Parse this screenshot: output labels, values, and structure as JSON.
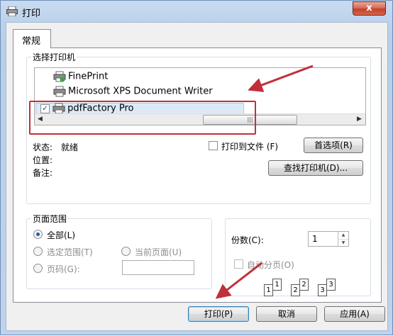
{
  "window": {
    "title": "打印",
    "close_symbol": "x",
    "icon": "printer-icon"
  },
  "tabs": [
    {
      "label": "常规",
      "selected": true
    }
  ],
  "select_printer": {
    "group_label": "选择打印机",
    "printers": [
      {
        "name": "FinePrint",
        "icon": "printer-icon",
        "selected": false
      },
      {
        "name": "Microsoft XPS Document Writer",
        "icon": "printer-icon",
        "selected": false
      },
      {
        "name": "pdfFactory Pro",
        "icon": "printer-icon",
        "selected": true,
        "checked": true
      }
    ],
    "scrollbar_thumb": "|||",
    "status_label": "状态:",
    "status_value": "就绪",
    "location_label": "位置:",
    "comment_label": "备注:",
    "print_to_file_label": "打印到文件 (F)",
    "print_to_file_checked": false,
    "preferences_button": "首选项(R)",
    "find_printer_button": "查找打印机(D)..."
  },
  "page_range": {
    "group_label": "页面范围",
    "options": [
      {
        "label": "全部(L)",
        "selected": true,
        "enabled": true
      },
      {
        "label": "选定范围(T)",
        "selected": false,
        "enabled": false
      },
      {
        "label": "当前页面(U)",
        "selected": false,
        "enabled": false
      },
      {
        "label": "页码(G):",
        "selected": false,
        "enabled": false
      }
    ],
    "pages_value": ""
  },
  "copies": {
    "label": "份数(C):",
    "value": "1",
    "collate_label": "自动分页(O)",
    "collate_checked": false,
    "collate_enabled": false,
    "collate_pages": [
      "1",
      "1",
      "2",
      "2",
      "3",
      "3"
    ]
  },
  "buttons": {
    "print": "打印(P)",
    "cancel": "取消",
    "apply": "应用(A)"
  },
  "colors": {
    "annotation": "#c0303a",
    "title_bar": "#bcd2ec",
    "close_button": "#c4402a"
  }
}
